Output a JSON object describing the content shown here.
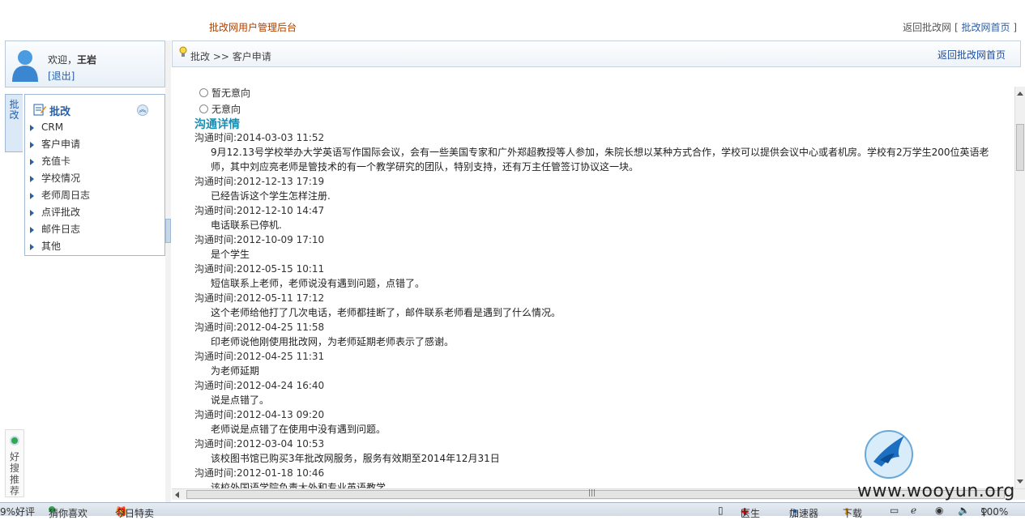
{
  "header": {
    "system_title": "批改网用户管理后台",
    "return_text": "返回批改网",
    "return_link_left": "[",
    "return_link": "批改网首页",
    "return_link_right": "]"
  },
  "user": {
    "welcome": "欢迎，",
    "name": "王岩",
    "logout": "[退出]"
  },
  "sidetab": {
    "label": "批改"
  },
  "menu": {
    "title": "批改",
    "items": [
      "CRM",
      "客户申请",
      "充值卡",
      "学校情况",
      "老师周日志",
      "点评批改",
      "邮件日志",
      "其他"
    ]
  },
  "breadcrumb": {
    "path": "批改   >>  客户申请",
    "home": "返回批改网首页"
  },
  "content": {
    "radio_1": "暂无意向",
    "radio_2": "无意向",
    "section_title": "沟通详情",
    "records": [
      {
        "time": "沟通时间:2014-03-03 11:52",
        "text": "9月12.13号学校举办大学英语写作国际会议，会有一些美国专家和广外郑超教授等人参加，朱院长想以某种方式合作，学校可以提供会议中心或者机房。学校有2万学生200位英语老师，其中刘应亮老师是管技术的有一个教学研究的团队，特别支持，还有万主任管签订协议这一块。"
      },
      {
        "time": "沟通时间:2012-12-13 17:19",
        "text": "已经告诉这个学生怎样注册."
      },
      {
        "time": "沟通时间:2012-12-10 14:47",
        "text": "电话联系已停机."
      },
      {
        "time": "沟通时间:2012-10-09 17:10",
        "text": "是个学生"
      },
      {
        "time": "沟通时间:2012-05-15 10:11",
        "text": "短信联系上老师，老师说没有遇到问题，点错了。"
      },
      {
        "time": "沟通时间:2012-05-11 17:12",
        "text": "这个老师给他打了几次电话，老师都挂断了，邮件联系老师看是遇到了什么情况。"
      },
      {
        "time": "沟通时间:2012-04-25 11:58",
        "text": "印老师说他刚使用批改网，为老师延期老师表示了感谢。"
      },
      {
        "time": "沟通时间:2012-04-25 11:31",
        "text": "为老师延期"
      },
      {
        "time": "沟通时间:2012-04-24 16:40",
        "text": "说是点错了。"
      },
      {
        "time": "沟通时间:2012-04-13 09:20",
        "text": "老师说是点错了在使用中没有遇到问题。"
      },
      {
        "time": "沟通时间:2012-03-04 10:53",
        "text": "该校图书馆已购买3年批改网服务，服务有效期至2014年12月31日"
      },
      {
        "time": "沟通时间:2012-01-18 10:46",
        "text": "该校外国语学院负责大外和专业英语教学"
      }
    ]
  },
  "haoso": {
    "label": "好搜推荐"
  },
  "statusbar": {
    "good_review": "9%好评",
    "guess": "猜你喜欢",
    "today": "今日特卖",
    "doctor": "医生",
    "accelerator": "加速器",
    "download": "下载",
    "zoom": "100%"
  },
  "watermark": {
    "text": "www.wooyun.org"
  },
  "colors": {
    "accent": "#2a5fa8",
    "section": "#1a8fb3",
    "brand": "#b04000"
  }
}
